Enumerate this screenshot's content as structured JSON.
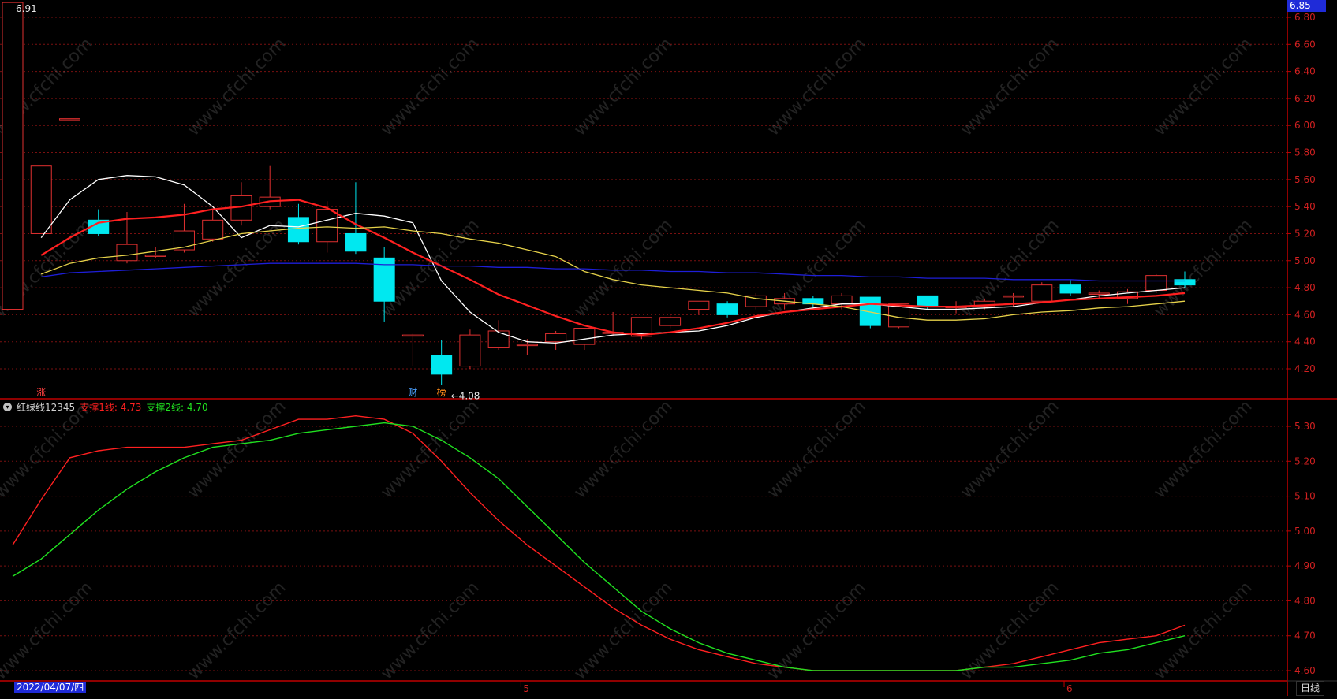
{
  "chart_data": [
    {
      "type": "candlestick",
      "ylim": [
        4.08,
        6.91
      ],
      "y_ticks": [
        "6.85",
        "6.80",
        "6.60",
        "6.40",
        "6.20",
        "6.00",
        "5.80",
        "5.60",
        "5.40",
        "5.20",
        "5.00",
        "4.80",
        "4.60",
        "4.40",
        "4.20"
      ],
      "annotations": {
        "high_label": "6.91",
        "low_label": "←4.08",
        "price_marker": "6.85"
      },
      "markers": [
        {
          "index": 1,
          "text": "涨",
          "color": "#ff4040"
        },
        {
          "index": 14,
          "text": "财",
          "color": "#4aa0ff"
        },
        {
          "index": 15,
          "text": "榜",
          "color": "#ff8c1a"
        }
      ],
      "candles": [
        {
          "o": 4.64,
          "h": 6.91,
          "l": 4.64,
          "c": 6.91
        },
        {
          "o": 5.2,
          "h": 5.7,
          "l": 5.2,
          "c": 5.7
        },
        {
          "o": 6.05,
          "h": 6.05,
          "l": 6.05,
          "c": 6.05
        },
        {
          "o": 5.3,
          "h": 5.38,
          "l": 5.18,
          "c": 5.2
        },
        {
          "o": 5.0,
          "h": 5.36,
          "l": 4.98,
          "c": 5.12
        },
        {
          "o": 5.04,
          "h": 5.1,
          "l": 5.02,
          "c": 5.04
        },
        {
          "o": 5.08,
          "h": 5.42,
          "l": 5.06,
          "c": 5.22
        },
        {
          "o": 5.16,
          "h": 5.38,
          "l": 5.14,
          "c": 5.3
        },
        {
          "o": 5.3,
          "h": 5.58,
          "l": 5.26,
          "c": 5.48
        },
        {
          "o": 5.4,
          "h": 5.7,
          "l": 5.38,
          "c": 5.47
        },
        {
          "o": 5.32,
          "h": 5.42,
          "l": 5.12,
          "c": 5.14
        },
        {
          "o": 5.14,
          "h": 5.44,
          "l": 5.06,
          "c": 5.38
        },
        {
          "o": 5.2,
          "h": 5.58,
          "l": 5.05,
          "c": 5.07
        },
        {
          "o": 5.02,
          "h": 5.1,
          "l": 4.55,
          "c": 4.7
        },
        {
          "o": 4.45,
          "h": 4.46,
          "l": 4.22,
          "c": 4.45
        },
        {
          "o": 4.3,
          "h": 4.41,
          "l": 4.08,
          "c": 4.16
        },
        {
          "o": 4.22,
          "h": 4.49,
          "l": 4.2,
          "c": 4.45
        },
        {
          "o": 4.36,
          "h": 4.56,
          "l": 4.34,
          "c": 4.48
        },
        {
          "o": 4.38,
          "h": 4.42,
          "l": 4.3,
          "c": 4.38
        },
        {
          "o": 4.4,
          "h": 4.48,
          "l": 4.34,
          "c": 4.46
        },
        {
          "o": 4.38,
          "h": 4.49,
          "l": 4.34,
          "c": 4.5
        },
        {
          "o": 4.47,
          "h": 4.62,
          "l": 4.44,
          "c": 4.47
        },
        {
          "o": 4.44,
          "h": 4.58,
          "l": 4.42,
          "c": 4.58
        },
        {
          "o": 4.52,
          "h": 4.6,
          "l": 4.5,
          "c": 4.58
        },
        {
          "o": 4.64,
          "h": 4.7,
          "l": 4.6,
          "c": 4.7
        },
        {
          "o": 4.68,
          "h": 4.7,
          "l": 4.58,
          "c": 4.6
        },
        {
          "o": 4.66,
          "h": 4.76,
          "l": 4.64,
          "c": 4.74
        },
        {
          "o": 4.68,
          "h": 4.76,
          "l": 4.64,
          "c": 4.72
        },
        {
          "o": 4.72,
          "h": 4.74,
          "l": 4.66,
          "c": 4.68
        },
        {
          "o": 4.68,
          "h": 4.76,
          "l": 4.64,
          "c": 4.74
        },
        {
          "o": 4.73,
          "h": 4.73,
          "l": 4.5,
          "c": 4.52
        },
        {
          "o": 4.51,
          "h": 4.68,
          "l": 4.5,
          "c": 4.68
        },
        {
          "o": 4.74,
          "h": 4.74,
          "l": 4.64,
          "c": 4.66
        },
        {
          "o": 4.66,
          "h": 4.7,
          "l": 4.61,
          "c": 4.66
        },
        {
          "o": 4.66,
          "h": 4.72,
          "l": 4.64,
          "c": 4.7
        },
        {
          "o": 4.74,
          "h": 4.76,
          "l": 4.66,
          "c": 4.74
        },
        {
          "o": 4.7,
          "h": 4.84,
          "l": 4.7,
          "c": 4.82
        },
        {
          "o": 4.82,
          "h": 4.86,
          "l": 4.74,
          "c": 4.76
        },
        {
          "o": 4.76,
          "h": 4.78,
          "l": 4.72,
          "c": 4.76
        },
        {
          "o": 4.72,
          "h": 4.79,
          "l": 4.68,
          "c": 4.77
        },
        {
          "o": 4.78,
          "h": 4.9,
          "l": 4.76,
          "c": 4.89
        },
        {
          "o": 4.86,
          "h": 4.92,
          "l": 4.8,
          "c": 4.82
        }
      ],
      "ma_series": [
        {
          "color": "#ffffff",
          "values": [
            null,
            5.17,
            5.45,
            5.6,
            5.63,
            5.62,
            5.56,
            5.4,
            5.17,
            5.26,
            5.25,
            5.3,
            5.35,
            5.33,
            5.28,
            4.85,
            4.62,
            4.47,
            4.4,
            4.39,
            4.42,
            4.45,
            4.46,
            4.47,
            4.48,
            4.52,
            4.58,
            4.62,
            4.65,
            4.68,
            4.68,
            4.66,
            4.64,
            4.64,
            4.65,
            4.66,
            4.69,
            4.71,
            4.74,
            4.76,
            4.78,
            4.8
          ]
        },
        {
          "color": "#ff2020",
          "values": [
            null,
            5.04,
            5.17,
            5.28,
            5.31,
            5.32,
            5.34,
            5.38,
            5.4,
            5.44,
            5.45,
            5.39,
            5.27,
            5.17,
            5.06,
            4.96,
            4.86,
            4.75,
            4.67,
            4.59,
            4.52,
            4.47,
            4.45,
            4.47,
            4.5,
            4.54,
            4.59,
            4.62,
            4.64,
            4.66,
            4.68,
            4.67,
            4.66,
            4.66,
            4.67,
            4.68,
            4.69,
            4.71,
            4.72,
            4.73,
            4.74,
            4.76
          ]
        },
        {
          "color": "#e6d24a",
          "values": [
            null,
            4.9,
            4.98,
            5.02,
            5.04,
            5.07,
            5.1,
            5.15,
            5.2,
            5.22,
            5.24,
            5.25,
            5.24,
            5.25,
            5.22,
            5.2,
            5.16,
            5.13,
            5.08,
            5.03,
            4.92,
            4.86,
            4.82,
            4.8,
            4.78,
            4.76,
            4.72,
            4.7,
            4.68,
            4.66,
            4.62,
            4.58,
            4.56,
            4.56,
            4.57,
            4.6,
            4.62,
            4.63,
            4.65,
            4.66,
            4.68,
            4.7
          ]
        },
        {
          "color": "#1e1ed8",
          "values": [
            null,
            4.88,
            4.91,
            4.92,
            4.93,
            4.94,
            4.95,
            4.96,
            4.97,
            4.98,
            4.98,
            4.98,
            4.98,
            4.97,
            4.97,
            4.96,
            4.96,
            4.95,
            4.95,
            4.94,
            4.94,
            4.93,
            4.93,
            4.92,
            4.92,
            4.91,
            4.91,
            4.9,
            4.89,
            4.89,
            4.88,
            4.88,
            4.87,
            4.87,
            4.87,
            4.86,
            4.86,
            4.86,
            4.85,
            4.85,
            4.85,
            4.85
          ]
        }
      ]
    },
    {
      "type": "line",
      "title": "红绿线12345",
      "legend_items": [
        {
          "label": "支撑1线: 4.73",
          "color": "#ff2020"
        },
        {
          "label": "支撑2线: 4.70",
          "color": "#20e020"
        }
      ],
      "ylim": [
        4.6,
        5.33
      ],
      "y_ticks": [
        "5.30",
        "5.20",
        "5.10",
        "5.00",
        "4.90",
        "4.80",
        "4.70",
        "4.60"
      ],
      "series": [
        {
          "name": "支撑1线",
          "color": "#ff2020",
          "values": [
            4.96,
            5.09,
            5.21,
            5.23,
            5.24,
            5.24,
            5.24,
            5.25,
            5.26,
            5.29,
            5.32,
            5.32,
            5.33,
            5.32,
            5.28,
            5.2,
            5.11,
            5.03,
            4.96,
            4.9,
            4.84,
            4.78,
            4.73,
            4.69,
            4.66,
            4.64,
            4.62,
            4.61,
            4.6,
            4.6,
            4.6,
            4.6,
            4.6,
            4.6,
            4.61,
            4.62,
            4.64,
            4.66,
            4.68,
            4.69,
            4.7,
            4.73
          ]
        },
        {
          "name": "支撑2线",
          "color": "#20e020",
          "values": [
            4.87,
            4.92,
            4.99,
            5.06,
            5.12,
            5.17,
            5.21,
            5.24,
            5.25,
            5.26,
            5.28,
            5.29,
            5.3,
            5.31,
            5.3,
            5.26,
            5.21,
            5.15,
            5.07,
            4.99,
            4.91,
            4.84,
            4.77,
            4.72,
            4.68,
            4.65,
            4.63,
            4.61,
            4.6,
            4.6,
            4.6,
            4.6,
            4.6,
            4.6,
            4.61,
            4.61,
            4.62,
            4.63,
            4.65,
            4.66,
            4.68,
            4.7
          ]
        }
      ]
    }
  ],
  "x_axis": {
    "start_date": "2022/04/07/四",
    "month_labels": [
      {
        "index": 18,
        "text": "5"
      },
      {
        "index": 37,
        "text": "6"
      }
    ]
  },
  "period_button": "日线",
  "watermark": "www.cfchi.com",
  "colors": {
    "up": "#e03030",
    "down": "#00e8f0",
    "grid": "#7a1010",
    "axis": "#c00000"
  }
}
